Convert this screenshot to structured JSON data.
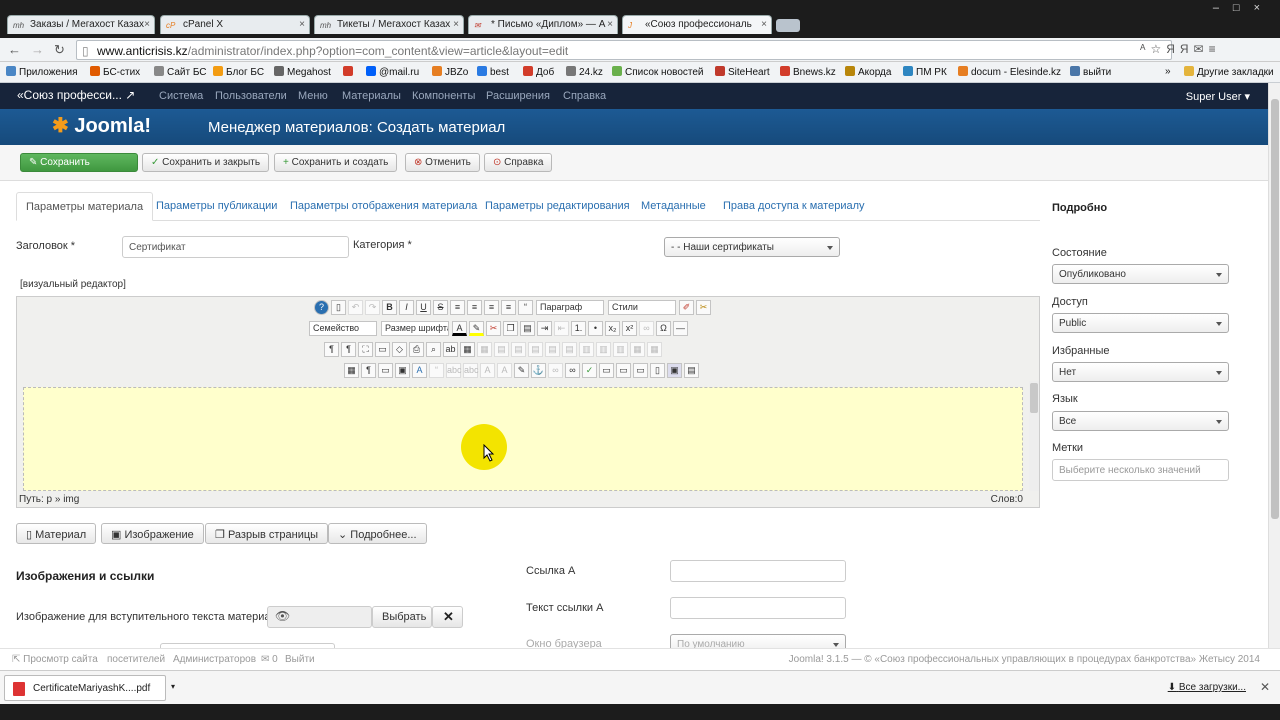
{
  "browser": {
    "tabs": [
      {
        "label": "Заказы / Мегахост Казах",
        "fav": "mh"
      },
      {
        "label": "cPanel X",
        "fav": "cP"
      },
      {
        "label": "Тикеты / Мегахост Казах",
        "fav": "mh"
      },
      {
        "label": "* Письмо «Диплом» — А",
        "fav": "✉"
      },
      {
        "label": "«Союз профессиональ",
        "fav": "J"
      }
    ],
    "url_host": "www.anticrisis.kz",
    "url_path": "/administrator/index.php?option=com_content&view=article&layout=edit",
    "bookmarks": [
      {
        "label": "Приложения",
        "color": "#4a86c5"
      },
      {
        "label": "БС-стих",
        "color": "#e05a00"
      },
      {
        "label": "Сайт БС",
        "color": "#888888"
      },
      {
        "label": "Блог БС",
        "color": "#f39c12"
      },
      {
        "label": "Megahost",
        "color": "#666666"
      },
      {
        "label": "",
        "color": "#d23c2a"
      },
      {
        "label": "@mail.ru",
        "color": "#005ff9"
      },
      {
        "label": "JBZo",
        "color": "#e67e22"
      },
      {
        "label": "best",
        "color": "#2a7ae2"
      },
      {
        "label": "Доб",
        "color": "#d23c2a"
      },
      {
        "label": "24.kz",
        "color": "#777777"
      },
      {
        "label": "Список новостей",
        "color": "#6ab04c"
      },
      {
        "label": "SiteHeart",
        "color": "#c0392b"
      },
      {
        "label": "Bnews.kz",
        "color": "#d23c2a"
      },
      {
        "label": "Акорда",
        "color": "#b8860b"
      },
      {
        "label": "ПМ РК",
        "color": "#2e86c1"
      },
      {
        "label": "docum - Elesinde.kz",
        "color": "#e67e22"
      },
      {
        "label": "выйти",
        "color": "#4a76a8"
      }
    ],
    "bookmarks_more": "»",
    "other_bookmarks": "Другие закладки"
  },
  "admin_nav": {
    "brand": "«Союз професси...",
    "items": [
      "Система",
      "Пользователи",
      "Меню",
      "Материалы",
      "Компоненты",
      "Расширения",
      "Справка"
    ],
    "user": "Super User"
  },
  "header": {
    "logo": "Joomla!",
    "title": "Менеджер материалов: Создать материал"
  },
  "toolbar": {
    "save": "Сохранить",
    "save_close": "Сохранить и закрыть",
    "save_new": "Сохранить и создать",
    "cancel": "Отменить",
    "help": "Справка"
  },
  "tabs": [
    "Параметры материала",
    "Параметры публикации",
    "Параметры отображения материала",
    "Параметры редактирования",
    "Метаданные",
    "Права доступа к материалу"
  ],
  "form": {
    "title_label": "Заголовок *",
    "title_value": "Сертификат",
    "category_label": "Категория *",
    "category_value": "- - Наши сертификаты",
    "visual_editor": "[визуальный редактор]"
  },
  "editor": {
    "paragraph": "Параграф",
    "styles": "Стили",
    "family": "Семейство",
    "size": "Размер шрифта",
    "path": "Путь: p » img",
    "words": "Слов:0"
  },
  "editor_buttons": {
    "article": "Материал",
    "image": "Изображение",
    "pagebreak": "Разрыв страницы",
    "readmore": "Подробнее..."
  },
  "images": {
    "heading": "Изображения и ссылки",
    "intro_label": "Изображение для вступительного текста материала",
    "choose": "Выбрать",
    "link_a": "Ссылка A",
    "link_text_a": "Текст ссылки A",
    "browser_window": "Окно браузера",
    "browser_window_value": "По умолчанию"
  },
  "sidebar": {
    "heading": "Подробно",
    "fields": [
      {
        "label": "Состояние",
        "value": "Опубликовано"
      },
      {
        "label": "Доступ",
        "value": "Public"
      },
      {
        "label": "Избранные",
        "value": "Нет"
      },
      {
        "label": "Язык",
        "value": "Все"
      }
    ],
    "tags_label": "Метки",
    "tags_placeholder": "Выберите несколько значений"
  },
  "footer": {
    "view_site": "Просмотр сайта",
    "visitors": "посетителей",
    "admins": "Администраторов",
    "messages": "0",
    "logout": "Выйти",
    "copyright": "Joomla! 3.1.5 — © «Союз профессиональных управляющих в процедурах банкротства» Жетысу 2014"
  },
  "downloads": {
    "file": "CertificateMariyashK....pdf",
    "all": "Все загрузки..."
  }
}
